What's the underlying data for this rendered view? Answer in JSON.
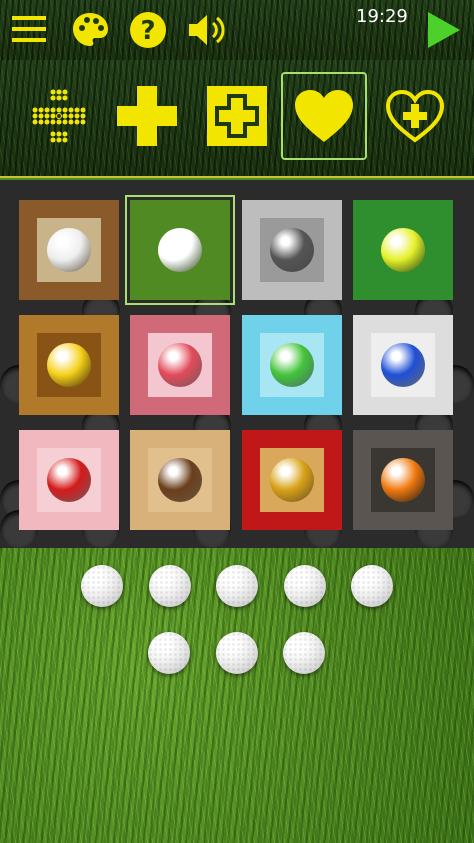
{
  "status": {
    "clock": "19:29"
  },
  "toolbar": {
    "icons": [
      "menu-icon",
      "palette-icon",
      "help-icon",
      "sound-icon",
      "play-icon"
    ],
    "accent": "#f2e600",
    "play_color": "#4cd12a"
  },
  "modes": {
    "items": [
      "dots-pattern",
      "cross",
      "hollow-cross",
      "heart",
      "heart-cross"
    ],
    "selected": "heart"
  },
  "themes": {
    "selected": "grass-golf",
    "items": [
      {
        "id": "burlap-pearl",
        "bg": "#8a5a2b",
        "inner": "#c9b48a",
        "ball": "#eeeeee"
      },
      {
        "id": "grass-golf",
        "bg": "#4f8a22",
        "inner": "#4f8a22",
        "ball": "#ffffff"
      },
      {
        "id": "metal-chrome",
        "bg": "#bdbdbd",
        "inner": "#9a9a9a",
        "ball": "#555555"
      },
      {
        "id": "turf-tennis",
        "bg": "#2f8f2f",
        "inner": "#2f8f2f",
        "ball": "#e6f02a"
      },
      {
        "id": "wood-smiley",
        "bg": "#b07a2a",
        "inner": "#8a5316",
        "ball": "#f5d11a"
      },
      {
        "id": "pink-glass",
        "bg": "#d06a78",
        "inner": "#f4c6cf",
        "ball": "#e24a5a"
      },
      {
        "id": "sky-green",
        "bg": "#6fd2ea",
        "inner": "#a9e6f3",
        "ball": "#43c43a"
      },
      {
        "id": "linen-blue",
        "bg": "#dddddd",
        "inner": "#eeeeee",
        "ball": "#1e4fd6"
      },
      {
        "id": "rose-heart",
        "bg": "#f2b8c0",
        "inner": "#f6cfd4",
        "ball": "#d41a1a"
      },
      {
        "id": "oak-brown",
        "bg": "#d8b07a",
        "inner": "#e2c08e",
        "ball": "#6b3f1c"
      },
      {
        "id": "velvet-gold",
        "bg": "#c01818",
        "inner": "#d9a85a",
        "ball": "#d8a216"
      },
      {
        "id": "stone-pumpkin",
        "bg": "#5a5550",
        "inner": "#3a3632",
        "ball": "#f07a10"
      }
    ]
  },
  "pegs": {
    "row1_count": 5,
    "row2_count": 3
  }
}
